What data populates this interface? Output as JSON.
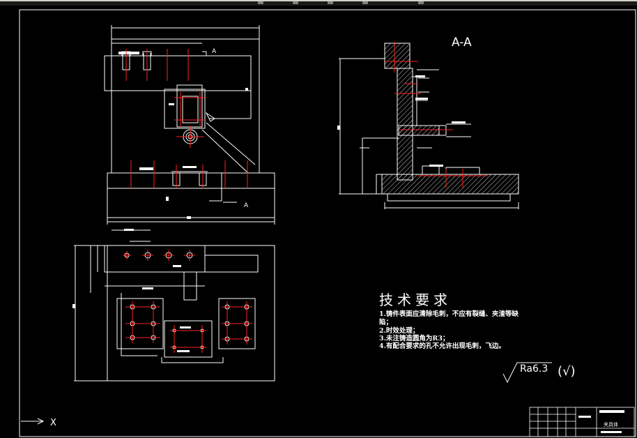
{
  "drawing": {
    "section_label": "A-A",
    "cut_label": "A",
    "tech_requirements": {
      "title": "技术要求",
      "lines": [
        "1.铸件表面应清除毛刺，不应有裂缝、夹渣等缺",
        "陷；",
        "2.时效处理；",
        "3.未注铸造圆角为R3；",
        "4.有配合要求的孔不允许出现毛刺，飞边。"
      ]
    },
    "roughness": {
      "value": "Ra6.3",
      "other": "(√)"
    },
    "title_block": {
      "part_name": "夹具体"
    },
    "ucs": {
      "x_label": "X"
    }
  },
  "colors": {
    "background": "#000000",
    "line": "#ffffff",
    "center_line": "#ff2020",
    "dimension": "#ffffff"
  }
}
